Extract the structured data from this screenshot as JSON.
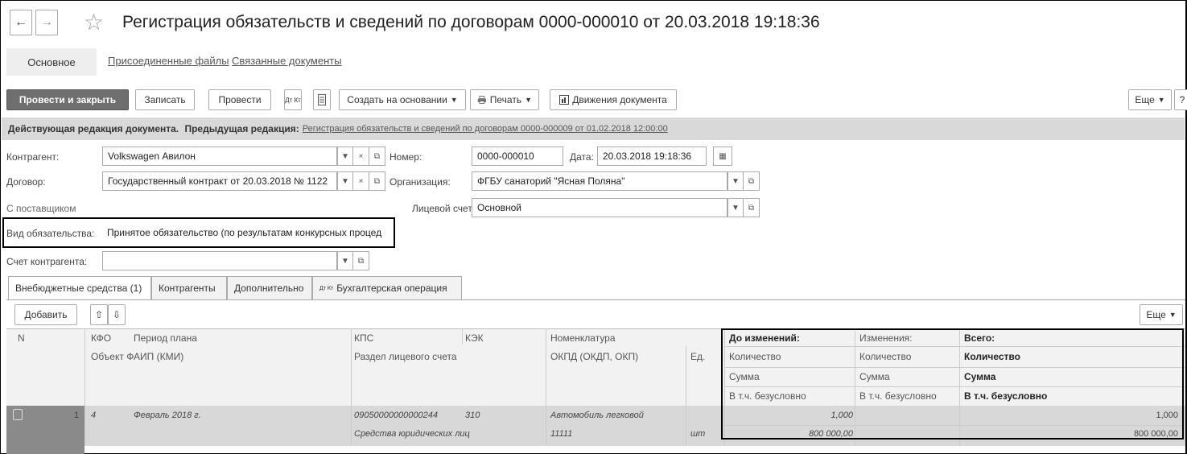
{
  "window": {
    "title": "Регистрация обязательств и сведений по договорам 0000-000010 от 20.03.2018 19:18:36"
  },
  "nav": {
    "back": "←",
    "forward": "→",
    "star": "☆"
  },
  "tabs": [
    "Основное",
    "Присоединенные файлы",
    "Связанные документы"
  ],
  "toolbar": {
    "post_close": "Провести и закрыть",
    "save": "Записать",
    "post": "Провести",
    "dt_kt": "Дт Кт",
    "create_based": "Создать на основании",
    "print": "Печать",
    "movements": "Движения документа",
    "more": "Еще",
    "help": "?"
  },
  "infobar": {
    "current": "Действующая редакция документа.",
    "prev_label": "Предыдущая редакция:",
    "prev_link": "Регистрация обязательств и сведений по договорам 0000-000009 от 01.02.2018 12:00:00"
  },
  "form": {
    "counterparty_label": "Контрагент:",
    "counterparty_value": "Volkswagen Авилон",
    "contract_label": "Договор:",
    "contract_value": "Государственный контракт от 20.03.2018 № 1122",
    "supplier_label": "С поставщиком",
    "obligation_label": "Вид обязательства:",
    "obligation_value": "Принятое обязательство (по результатам конкурсных процед",
    "account_label": "Счет контрагента:",
    "account_value": "",
    "number_label": "Номер:",
    "number_value": "0000-000010",
    "date_label": "Дата:",
    "date_value": "20.03.2018 19:18:36",
    "org_label": "Организация:",
    "org_value": "ФГБУ санаторий \"Ясная Поляна\"",
    "personal_label": "Лицевой счет:",
    "personal_value": "Основной"
  },
  "inner_tabs": [
    "Внебюджетные средства (1)",
    "Контрагенты",
    "Дополнительно",
    "Бухгалтерская операция"
  ],
  "table_toolbar": {
    "add": "Добавить",
    "more": "Еще"
  },
  "table": {
    "headers": {
      "n": "N",
      "kfo": "КФО",
      "period": "Период плана",
      "object": "Объект ФАИП (КМИ)",
      "kps": "КПС",
      "kek": "КЭК",
      "section": "Раздел лицевого счета",
      "nomenclature": "Номенклатура",
      "okpd": "ОКПД (ОКДП, ОКП)",
      "unit": "Ед.",
      "before": "До изменений:",
      "qty1": "Количество",
      "sum1": "Сумма",
      "uncond1": "В т.ч. безусловно",
      "changes": "Изменения:",
      "qty2": "Количество",
      "sum2": "Сумма",
      "uncond2": "В т.ч. безусловно",
      "total": "Всего:",
      "qty3": "Количество",
      "sum3": "Сумма",
      "uncond3": "В т.ч. безусловно"
    },
    "row": {
      "n": "1",
      "kfo": "4",
      "period": "Февраль 2018 г.",
      "kps": "09050000000000244",
      "kek": "310",
      "nomenclature": "Автомобиль легковой",
      "section": "Средства юридических лиц",
      "okpd": "11111",
      "unit": "шт",
      "before_qty": "1,000",
      "before_sum": "800 000,00",
      "total_qty": "1,000",
      "total_sum": "800 000,00"
    }
  }
}
